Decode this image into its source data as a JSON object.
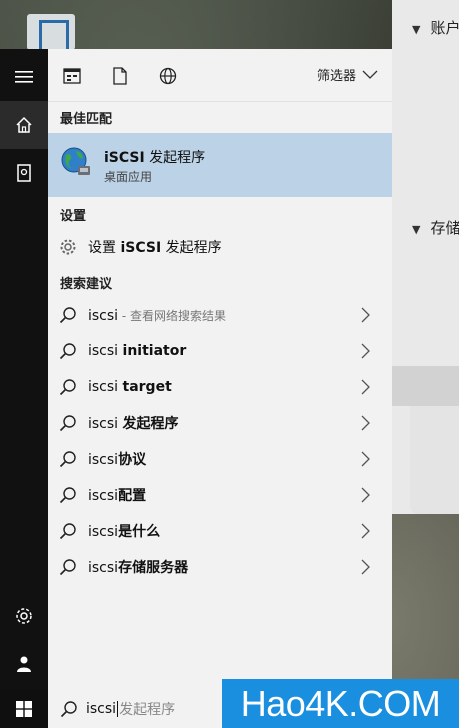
{
  "background_window": {
    "header1": "账户",
    "header2": "存储"
  },
  "rail": {
    "items": [
      {
        "name": "hamburger-icon"
      },
      {
        "name": "home-icon"
      },
      {
        "name": "documents-icon"
      },
      {
        "name": "settings-icon"
      },
      {
        "name": "user-icon"
      }
    ]
  },
  "toolbar": {
    "icons": [
      "apps-icon",
      "document-icon",
      "web-icon"
    ],
    "filter_label": "筛选器"
  },
  "best_match": {
    "title": "最佳匹配",
    "app_name_prefix": "iSCSI",
    "app_name_rest": " 发起程序",
    "app_type": "桌面应用"
  },
  "settings": {
    "title": "设置",
    "item_prefix": "设置 ",
    "item_bold": "iSCSI",
    "item_rest": " 发起程序"
  },
  "suggestions": {
    "title": "搜索建议",
    "items": [
      {
        "query": "iscsi",
        "bold": "",
        "extra": " - 查看网络搜索结果"
      },
      {
        "query": "iscsi ",
        "bold": "initiator",
        "extra": ""
      },
      {
        "query": "iscsi ",
        "bold": "target",
        "extra": ""
      },
      {
        "query": "iscsi ",
        "bold": "发起程序",
        "extra": ""
      },
      {
        "query": "iscsi",
        "bold": "协议",
        "extra": ""
      },
      {
        "query": "iscsi",
        "bold": "配置",
        "extra": ""
      },
      {
        "query": "iscsi",
        "bold": "是什么",
        "extra": ""
      },
      {
        "query": "iscsi",
        "bold": "存储服务器",
        "extra": ""
      }
    ]
  },
  "search": {
    "typed": "iscsi",
    "hint": "发起程序"
  },
  "watermark": "Hao4K.COM",
  "colors": {
    "accent_selected": "#bcd2e6",
    "panel_bg": "#f2f2f2",
    "rail_bg": "#111111",
    "watermark_bg": "#1a8fe0"
  }
}
